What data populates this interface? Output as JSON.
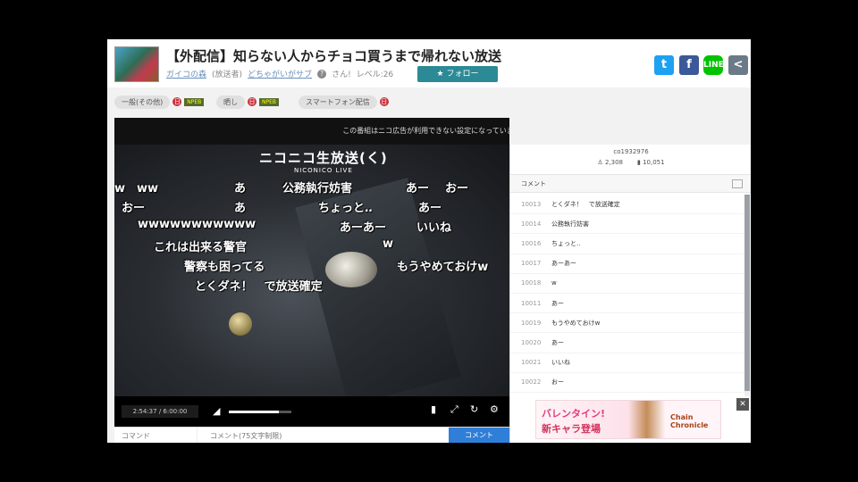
{
  "header": {
    "title": "【外配信】知らない人からチョコ買うまで帰れない放送",
    "community": "ガイコの森",
    "broadcaster_label": "(放送者)",
    "broadcaster": "どちゃがいがサブ",
    "viewers_suffix": "さん!",
    "level": "レベル:26",
    "follow_label": "★ フォロー",
    "share": {
      "twitter": "t",
      "facebook": "f",
      "line": "LINE",
      "share": "<"
    }
  },
  "tags": [
    {
      "label": "一般(その他)",
      "badge": "日",
      "nico": "NPEB"
    },
    {
      "label": "晒し",
      "badge": "日",
      "nico": "NPEB"
    },
    {
      "label": "スマートフォン配信",
      "badge": "日"
    }
  ],
  "player": {
    "notice": "この番組はニコ広告が利用できない設定になっています",
    "logo": "ニコニコ生放送(く)",
    "logo_sub": "NICONICO LIVE",
    "overlay_comments": [
      "w　ww",
      "あ",
      "公務執行妨害",
      "あー",
      "おー",
      "おー",
      "あ",
      "ちょっと‥",
      "あー",
      "wwwwwwwwwww",
      "あーあー",
      "いいね",
      "これは出来る警官",
      "w",
      "警察も困ってる",
      "もうやめておけw",
      "とくダネ！　で放送確定"
    ],
    "time": "2:54:37 / 6:00:00",
    "volume": 0.8
  },
  "input": {
    "command_placeholder": "コマンド",
    "comment_placeholder": "コメント(75文字制限)",
    "send_label": "コメント"
  },
  "side": {
    "program_id": "co1932976",
    "viewers": "2,308",
    "comments_count": "10,051",
    "comment_header": "コメント",
    "comments": [
      {
        "no": "10013",
        "text": "とくダネ！　で放送確定"
      },
      {
        "no": "10014",
        "text": "公務執行妨害"
      },
      {
        "no": "10016",
        "text": "ちょっと‥"
      },
      {
        "no": "10017",
        "text": "あーあー"
      },
      {
        "no": "10018",
        "text": "w"
      },
      {
        "no": "10011",
        "text": "あー"
      },
      {
        "no": "10019",
        "text": "もうやめておけw"
      },
      {
        "no": "10020",
        "text": "あー"
      },
      {
        "no": "10021",
        "text": "いいね"
      },
      {
        "no": "10022",
        "text": "おー"
      }
    ],
    "ad": {
      "line1": "バレンタイン!",
      "line2": "新キャラ登場",
      "logo": "Chain Chronicle",
      "close": "✕"
    }
  }
}
